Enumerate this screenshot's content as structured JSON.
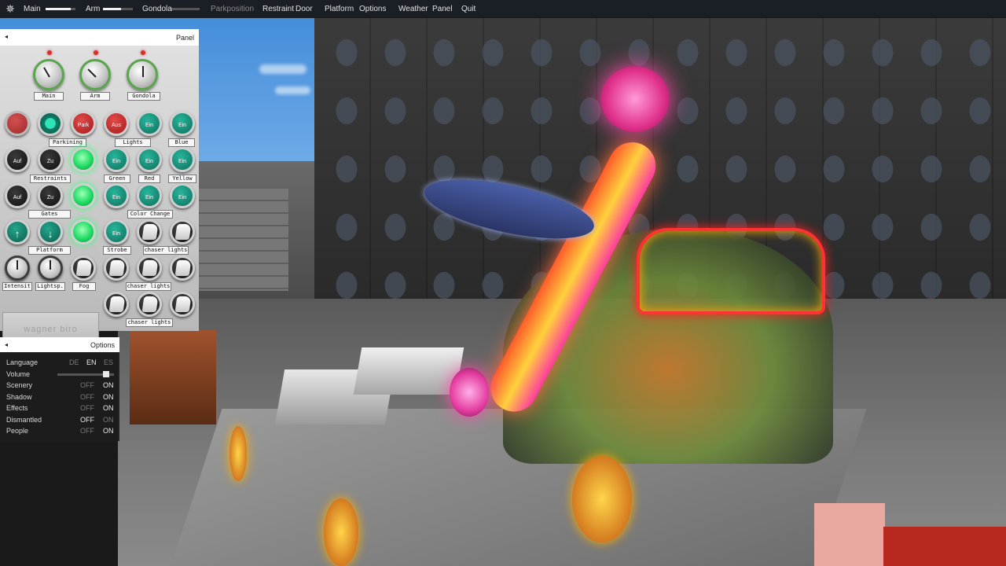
{
  "menubar": {
    "main_label": "Main",
    "arm_label": "Arm",
    "gondola_label": "Gondola",
    "parkposition_label": "Parkposition",
    "restraint_label": "Restraint",
    "door_label": "Door",
    "platform_label": "Platform",
    "options_label": "Options",
    "weather_label": "Weather",
    "panel_label": "Panel",
    "quit_label": "Quit",
    "main_slider_level": 0.85,
    "arm_slider_level": 0.6,
    "gondola_slider_level": 0.0
  },
  "panel": {
    "title": "Panel",
    "knobs": {
      "main": "Main",
      "arm": "Arm",
      "gondola": "Gondola"
    },
    "buttons": {
      "park": "Park",
      "aus": "Aus",
      "ein": "Ein",
      "auf": "Auf",
      "zu": "Zu"
    },
    "labels": {
      "parkining": "Parkining",
      "lights": "Lights",
      "blue": "Blue",
      "restraints": "Restraints",
      "green": "Green",
      "red": "Red",
      "yellow": "Yellow",
      "gates": "Gates",
      "color_change": "Color Change",
      "platform": "Platform",
      "strobe": "Strobe",
      "chaser_lights": "chaser lights",
      "intensity": "Intensit",
      "lightsp": "Lightsp.",
      "fog": "Fog"
    },
    "brand": "wagner biro"
  },
  "options": {
    "title": "Options",
    "language": {
      "label": "Language",
      "choices": [
        "DE",
        "EN",
        "ES"
      ],
      "selected": "EN"
    },
    "volume": {
      "label": "Volume",
      "level": 0.9
    },
    "off": "OFF",
    "on": "ON",
    "rows": [
      {
        "label": "Scenery",
        "value": "ON"
      },
      {
        "label": "Shadow",
        "value": "ON"
      },
      {
        "label": "Effects",
        "value": "ON"
      },
      {
        "label": "Dismantled",
        "value": "OFF"
      },
      {
        "label": "People",
        "value": "ON"
      }
    ]
  },
  "colors": {
    "menubar_bg": "#161616",
    "button_red": "#a51a1a",
    "button_teal": "#0e6f5c",
    "button_lit": "#1edc63"
  }
}
